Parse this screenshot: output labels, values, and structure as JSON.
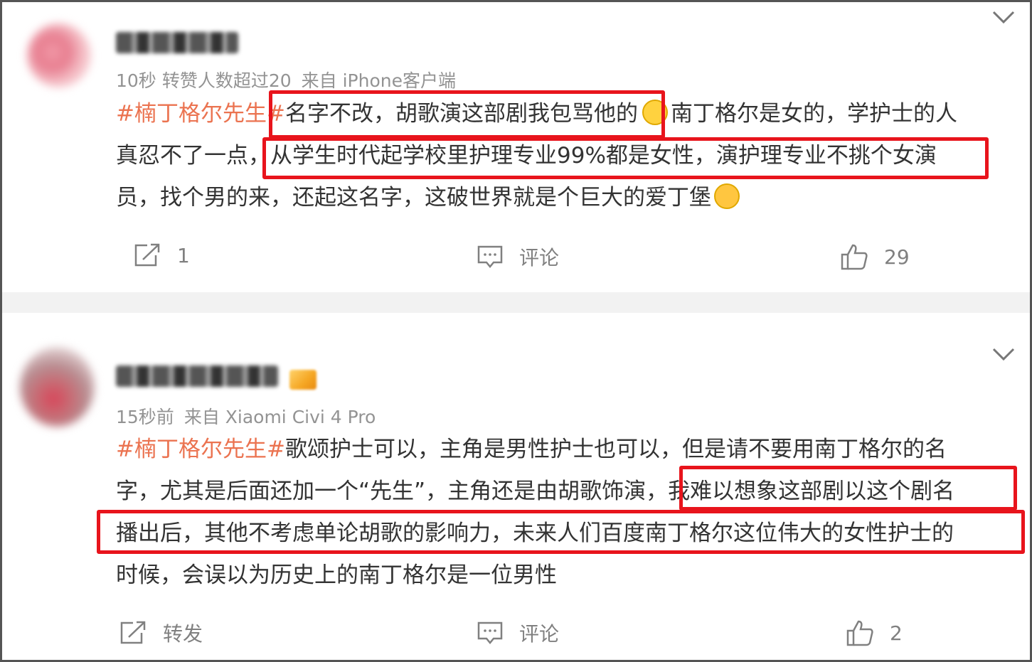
{
  "posts": [
    {
      "meta": {
        "time": "10秒",
        "extra": "转赞人数超过20",
        "source": "来自 iPhone客户端"
      },
      "text": {
        "hashtag": "#楠丁格尔先生#",
        "line1_a": "名字不改，胡歌演这部剧我包骂他的",
        "emoji1": "🙂",
        "line1_b": "南丁格尔是女的，学护士的人",
        "line2": "真忍不了一点，从学生时代起学校里护理专业99%都是女性，演护理专业不挑个女演",
        "line3": "员，找个男的来，还起这名字，这破世界就是个巨大的爱丁堡",
        "emoji2": "😤"
      },
      "actions": {
        "share_count": "1",
        "comment_label": "评论",
        "like_count": "29"
      }
    },
    {
      "meta": {
        "time": "15秒前",
        "source": "来自 Xiaomi Civi 4 Pro"
      },
      "text": {
        "hashtag": "#楠丁格尔先生#",
        "line1": "歌颂护士可以，主角是男性护士也可以，但是请不要用南丁格尔的名",
        "line2": "字，尤其是后面还加一个“先生”，主角还是由胡歌饰演，我难以想象这部剧以这个剧名",
        "line3": "播出后，其他不考虑单论胡歌的影响力，未来人们百度南丁格尔这位伟大的女性护士的",
        "line4": "时候，会误以为历史上的南丁格尔是一位男性"
      },
      "actions": {
        "share_label": "转发",
        "comment_label": "评论",
        "like_count": "2"
      }
    }
  ],
  "colors": {
    "hashtag": "#eb7350",
    "highlight_box": "#e8141c",
    "meta_text": "#939393",
    "separator": "#f2f2f2"
  },
  "icons": [
    "share-icon",
    "comment-icon",
    "like-icon",
    "chevron-down-icon"
  ]
}
